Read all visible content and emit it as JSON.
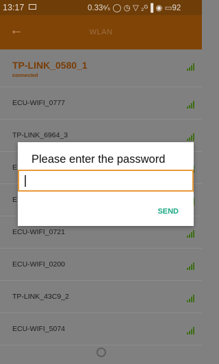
{
  "status_bar": {
    "time": "13:17",
    "right_text": "0.33⁶⁄ₛ ◯ ◷ ▽ ₂ᴳ▐ ◉ ▭92"
  },
  "app_bar": {
    "title": "WLAN"
  },
  "networks": [
    {
      "name": "TP-LINK_0580_1",
      "status": "connected"
    },
    {
      "name": "ECU-WIFI_0777"
    },
    {
      "name": "TP-LINK_6964_3"
    },
    {
      "name": "E"
    },
    {
      "name": "E"
    },
    {
      "name": "ECU-WIFI_0721"
    },
    {
      "name": "ECU-WIFI_0200"
    },
    {
      "name": "TP-LINK_43C9_2"
    },
    {
      "name": "ECU-WIFI_5074"
    }
  ],
  "dialog": {
    "title": "Please enter the password",
    "password_value": "",
    "send_label": "SEND"
  },
  "colors": {
    "app_bar": "#804407",
    "accent": "#e99a3a",
    "send": "#1aa683"
  }
}
